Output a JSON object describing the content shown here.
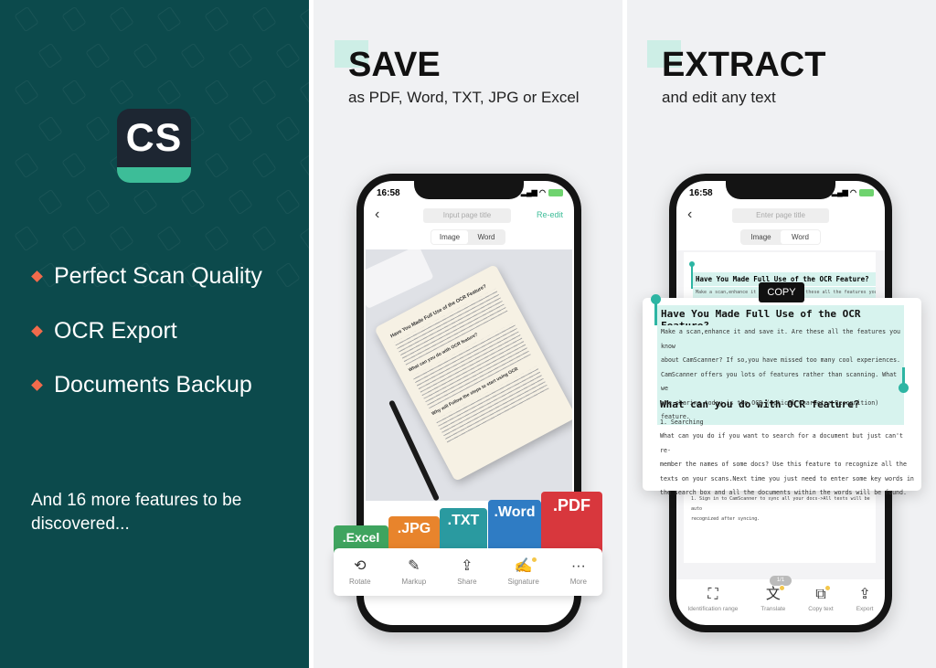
{
  "left": {
    "logo_text": "CS",
    "features": [
      "Perfect Scan Quality",
      "OCR Export",
      "Documents Backup"
    ],
    "more": "And 16 more features to be discovered...",
    "colors": {
      "bg": "#0c4a4c",
      "bullet": "#f26b4c",
      "logo_bar": "#3dbd98"
    }
  },
  "save": {
    "title": "SAVE",
    "subtitle": "as PDF, Word, TXT, JPG or Excel",
    "phone": {
      "time": "16:58",
      "title_placeholder": "Input page title",
      "reedit": "Re-edit",
      "tabs": [
        "Image",
        "Word"
      ],
      "doc_heading": "Have You Made Full Use of the OCR Feature?",
      "doc_sub": "What can you do with OCR feature?",
      "doc_sub2": "Why will Follow the steps to start using OCR",
      "formats": [
        {
          "label": ".Excel",
          "color": "#3fa45f"
        },
        {
          "label": ".JPG",
          "color": "#e8842c"
        },
        {
          "label": ".TXT",
          "color": "#2a9aa0"
        },
        {
          "label": ".Word",
          "color": "#2f7cc4"
        },
        {
          "label": ".PDF",
          "color": "#d8373d"
        }
      ],
      "toolbar": [
        {
          "label": "Rotate",
          "icon": "rotate-icon"
        },
        {
          "label": "Markup",
          "icon": "pen-icon"
        },
        {
          "label": "Share",
          "icon": "share-icon"
        },
        {
          "label": "Signature",
          "icon": "signature-icon"
        },
        {
          "label": "More",
          "icon": "more-icon"
        }
      ]
    }
  },
  "extract": {
    "title": "EXTRACT",
    "subtitle": "and edit any text",
    "phone": {
      "time": "16:58",
      "title_placeholder": "Enter page title",
      "tabs": [
        "Image",
        "Word"
      ],
      "bg_heading": "Have You Made Full Use of the OCR Feature?",
      "bg_line": "Make a scan,enhance it and save it. Are these all the features you know",
      "copy": "COPY",
      "card_heading": "Have You Made Full Use of the OCR Feature?",
      "card_para": [
        "Make a scan,enhance it and save it. Are these all the features you know",
        "about CamScanner? If so,you have missed too many cool experiences.",
        "CamScanner offers you lots of features rather than scanning. What we",
        "are sharing today is the OCR (Optical Character Recognition) feature."
      ],
      "card_sub": "What can you do with OCR feature?",
      "card_item": "1. Searching",
      "card_para2": [
        "What can you do if you want to search for a document but just can't re-",
        "member the names of some docs? Use this feature to recognize all the",
        "texts on your scans.Next time you just need to enter some key words in",
        "the search box and all the documents within the words will be found."
      ],
      "after": [
        "1. Sign in to CamScanner to sync all your docs->All texts will be auto",
        "recognized after syncing."
      ],
      "page": "1/1",
      "toolbar": [
        {
          "label": "Identification range",
          "icon": "scan-range-icon"
        },
        {
          "label": "Translate",
          "icon": "translate-icon"
        },
        {
          "label": "Copy text",
          "icon": "copy-icon"
        },
        {
          "label": "Export",
          "icon": "export-icon"
        }
      ],
      "accent": "#2db5a3"
    }
  }
}
